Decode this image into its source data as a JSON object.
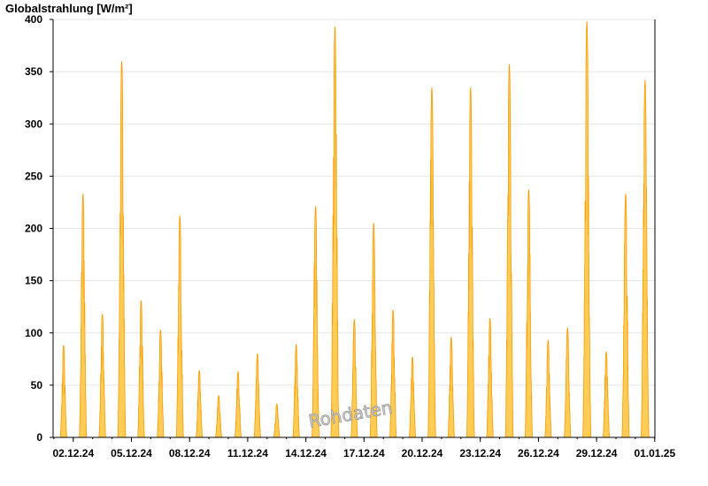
{
  "chart_data": {
    "type": "area",
    "title": "",
    "ylabel": "Globalstrahlung [W/m²]",
    "xlabel": "",
    "ylim": [
      0,
      400
    ],
    "yticks": [
      0,
      50,
      100,
      150,
      200,
      250,
      300,
      350,
      400
    ],
    "xlim": [
      "01.12.24",
      "01.01.25"
    ],
    "xticks": [
      "02.12.24",
      "05.12.24",
      "08.12.24",
      "11.12.24",
      "14.12.24",
      "17.12.24",
      "20.12.24",
      "23.12.24",
      "26.12.24",
      "29.12.24",
      "01.01.25"
    ],
    "grid": true,
    "fill_color": "#ffcc55",
    "line_color": "#ff9900",
    "watermark": "Rohdaten",
    "series": [
      {
        "x_unit": "day of December 2024 (daily noon peak)",
        "days": [
          1.5,
          2.5,
          3.5,
          4.5,
          5.5,
          6.5,
          7.5,
          8.5,
          9.5,
          10.5,
          11.5,
          12.5,
          13.5,
          14.5,
          15.5,
          16.5,
          17.5,
          18.5,
          19.5,
          20.5,
          21.5,
          22.5,
          23.5,
          24.5,
          25.5,
          26.5,
          27.5,
          28.5,
          29.5,
          30.5,
          31.5
        ],
        "peaks": [
          88,
          233,
          118,
          360,
          131,
          103,
          212,
          64,
          40,
          63,
          80,
          32,
          89,
          221,
          393,
          113,
          205,
          122,
          77,
          335,
          96,
          335,
          114,
          357,
          237,
          93,
          105,
          398,
          82,
          233,
          342
        ]
      }
    ]
  }
}
